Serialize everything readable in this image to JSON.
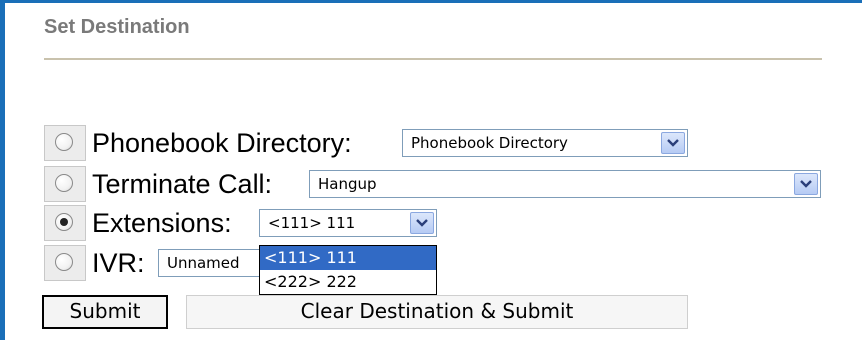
{
  "section": {
    "title": "Set Destination"
  },
  "rows": [
    {
      "label": "Phonebook Directory:",
      "selected_value": "Phonebook Directory",
      "checked": false
    },
    {
      "label": "Terminate Call:",
      "selected_value": "Hangup",
      "checked": false
    },
    {
      "label": "Extensions:",
      "selected_value": "<111> 111",
      "checked": true
    },
    {
      "label": "IVR:",
      "selected_value": "Unnamed",
      "checked": false
    }
  ],
  "extensions_dropdown": {
    "options": [
      "<111> 111",
      "<222> 222"
    ],
    "highlighted_index": 0
  },
  "buttons": {
    "submit": "Submit",
    "clear_submit": "Clear Destination & Submit"
  },
  "colors": {
    "frame": "#1a6fb8",
    "title": "#7a7a7a",
    "rule": "#c9c2ad",
    "select_border": "#7f9db9",
    "highlight": "#316ac5"
  }
}
